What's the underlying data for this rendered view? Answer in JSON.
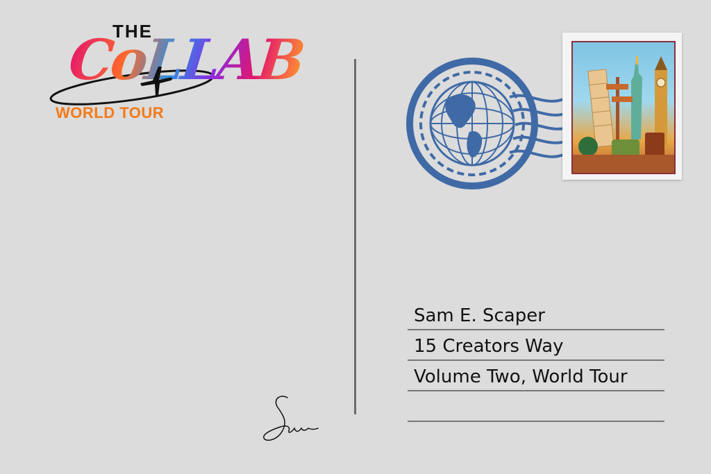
{
  "logo": {
    "the": "THE",
    "script": "CoLLAB",
    "subtitle": "WORLD TOUR",
    "plane_icon": "airplane-icon",
    "colors": {
      "subtitle": "#f47a18",
      "the": "#111111"
    }
  },
  "postmark": {
    "icon": "globe-postmark-icon",
    "color": "#3f6aa6"
  },
  "stamp": {
    "icon": "landmarks-stamp-icon",
    "border_color": "#8a2f3b"
  },
  "address": {
    "lines": [
      "Sam E. Scaper",
      "15 Creators Way",
      "Volume Two, World Tour",
      ""
    ]
  },
  "signature": {
    "icon": "handwritten-signature-icon"
  }
}
